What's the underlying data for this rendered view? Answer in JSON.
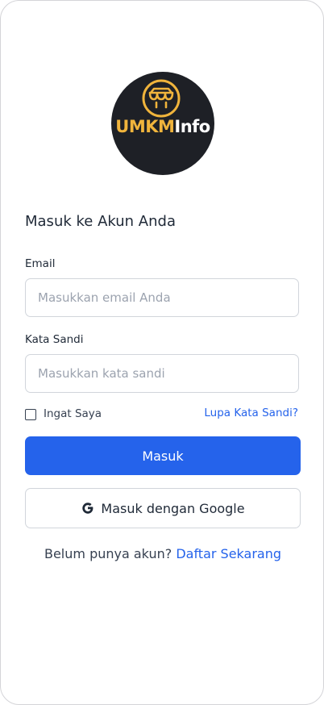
{
  "brand": {
    "logo_part1": "UMKM",
    "logo_part2": "Info",
    "accent_color": "#f0b43c",
    "logo_bg_color": "#1e2026",
    "icon": "storefront-icon"
  },
  "login": {
    "heading": "Masuk ke Akun Anda",
    "email_label": "Email",
    "email_placeholder": "Masukkan email Anda",
    "email_value": "",
    "password_label": "Kata Sandi",
    "password_placeholder": "Masukkan kata sandi",
    "password_value": "",
    "remember_label": "Ingat Saya",
    "remember_checked": false,
    "forgot_link": "Lupa Kata Sandi?",
    "submit_label": "Masuk",
    "google_label": "Masuk dengan Google",
    "google_icon": "google-icon",
    "signup_prompt": "Belum punya akun?",
    "signup_link": "Daftar Sekarang"
  },
  "colors": {
    "primary": "#2563eb",
    "text": "#1f2937",
    "border": "#d1d5db"
  }
}
